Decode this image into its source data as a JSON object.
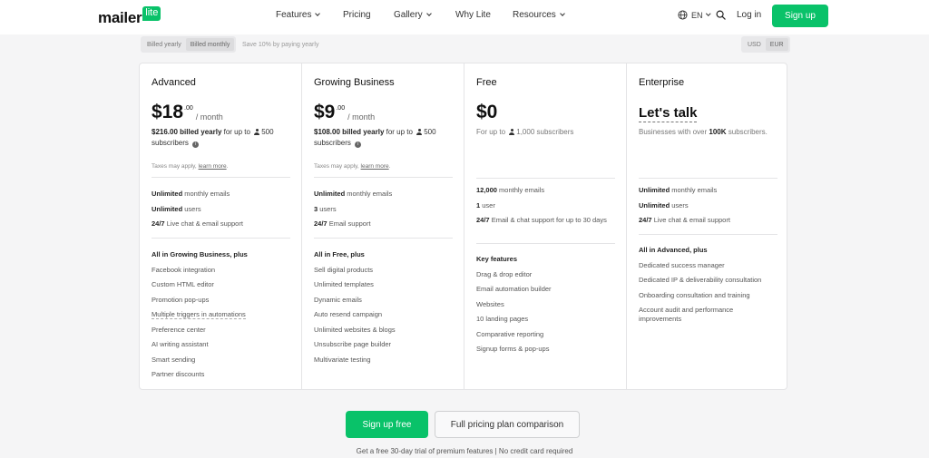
{
  "header": {
    "logo_text": "mailer",
    "logo_badge": "lite",
    "nav": [
      {
        "label": "Features",
        "dropdown": true
      },
      {
        "label": "Pricing",
        "dropdown": false
      },
      {
        "label": "Gallery",
        "dropdown": true
      },
      {
        "label": "Why Lite",
        "dropdown": false
      },
      {
        "label": "Resources",
        "dropdown": true
      }
    ],
    "language": "EN",
    "login": "Log in",
    "signup": "Sign up"
  },
  "billing": {
    "options": [
      "Billed yearly",
      "Billed monthly"
    ],
    "selected": "Billed monthly",
    "save_note": "Save 10% by paying yearly",
    "currencies": [
      "USD",
      "EUR"
    ],
    "selected_currency": "EUR"
  },
  "plans": {
    "advanced": {
      "name": "Advanced",
      "price": "$18",
      "cents": ".00",
      "per": "/ month",
      "billed_amount": "$216.00 billed yearly",
      "billed_for": "for up to",
      "subscribers_count": "500",
      "subscribers_word": "subscribers",
      "taxes": "Taxes may apply,",
      "learn_more": "learn more",
      "taxes_end": ".",
      "features": [
        {
          "bold": "Unlimited",
          "text": "monthly emails"
        },
        {
          "bold": "Unlimited",
          "text": "users"
        },
        {
          "bold": "24/7",
          "text": "Live chat & email support"
        }
      ],
      "extras_head": "All in Growing Business, plus",
      "extras": [
        "Facebook integration",
        "Custom HTML editor",
        "Promotion pop-ups",
        "Multiple triggers in automations",
        "Preference center",
        "AI writing assistant",
        "Smart sending",
        "Partner discounts"
      ]
    },
    "growing": {
      "name": "Growing Business",
      "price": "$9",
      "cents": ".00",
      "per": "/ month",
      "billed_amount": "$108.00 billed yearly",
      "billed_for": "for up to",
      "subscribers_count": "500",
      "subscribers_word": "subscribers",
      "taxes": "Taxes may apply,",
      "learn_more": "learn more",
      "taxes_end": ".",
      "features": [
        {
          "bold": "Unlimited",
          "text": "monthly emails"
        },
        {
          "bold": "3",
          "text": "users"
        },
        {
          "bold": "24/7",
          "text": "Email support"
        }
      ],
      "extras_head": "All in Free, plus",
      "extras": [
        "Sell digital products",
        "Unlimited templates",
        "Dynamic emails",
        "Auto resend campaign",
        "Unlimited websites & blogs",
        "Unsubscribe page builder",
        "Multivariate testing"
      ]
    },
    "free": {
      "name": "Free",
      "price": "$0",
      "desc_prefix": "For up to",
      "subscribers_count": "1,000",
      "subscribers_word": "subscribers",
      "features": [
        {
          "bold": "12,000",
          "text": "monthly emails"
        },
        {
          "bold": "1",
          "text": "user"
        },
        {
          "bold": "24/7",
          "text": "Email & chat support for up to 30 days"
        }
      ],
      "extras_head": "Key features",
      "extras": [
        "Drag & drop editor",
        "Email automation builder",
        "Websites",
        "10 landing pages",
        "Comparative reporting",
        "Signup forms & pop-ups"
      ]
    },
    "enterprise": {
      "name": "Enterprise",
      "talk": "Let's talk",
      "desc_prefix": "Businesses with over",
      "desc_bold": "100K",
      "desc_suffix": "subscribers.",
      "features": [
        {
          "bold": "Unlimited",
          "text": "monthly emails"
        },
        {
          "bold": "Unlimited",
          "text": "users"
        },
        {
          "bold": "24/7",
          "text": "Live chat & email support"
        }
      ],
      "extras_head": "All in Advanced, plus",
      "extras": [
        "Dedicated success manager",
        "Dedicated IP & deliverability consultation",
        "Onboarding consultation and training",
        "Account audit and performance improvements"
      ]
    }
  },
  "cta": {
    "signup_free": "Sign up free",
    "comparison": "Full pricing plan comparison",
    "trial_note": "Get a free 30-day trial of premium features | No credit card required"
  },
  "colors": {
    "brand_green": "#09c269"
  }
}
